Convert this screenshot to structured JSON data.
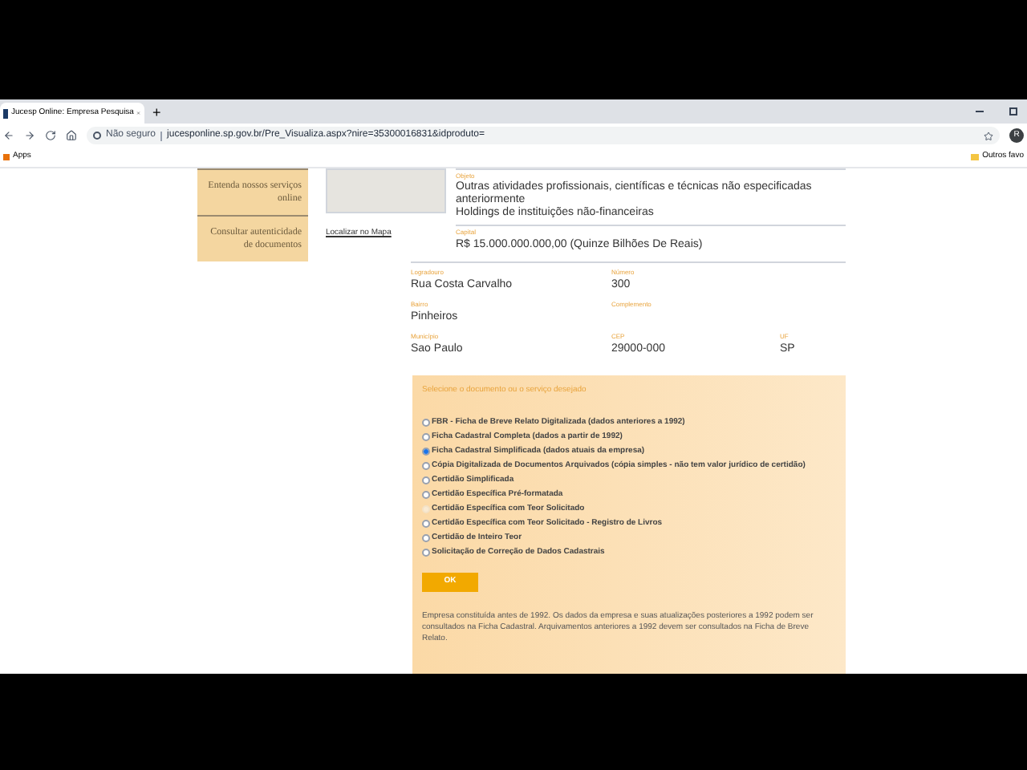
{
  "browser": {
    "tab_title": "Jucesp Online: Empresa Pesquisa",
    "new_tab": "+",
    "security": "Não seguro",
    "url": "jucesponline.sp.gov.br/Pre_Visualiza.aspx?nire=35300016831&idproduto=",
    "avatar": "R",
    "bookmarks": [
      "Apps"
    ],
    "other_bookmarks": "Outros favo"
  },
  "sidebar": {
    "items": [
      "Entenda nossos serviços online",
      "Consultar autenticidade de documentos"
    ]
  },
  "map": {
    "link": "Localizar no Mapa"
  },
  "objeto": {
    "label": "Objeto",
    "lines": [
      "Outras atividades profissionais, científicas e técnicas não especificadas anteriormente",
      "Holdings de instituições não-financeiras"
    ]
  },
  "capital": {
    "label": "Capital",
    "value": "R$ 15.000.000.000,00 (Quinze Bilhões De Reais)"
  },
  "address": [
    [
      {
        "label": "Logradouro",
        "value": "Rua Costa Carvalho"
      },
      {
        "label": "Número",
        "value": "300"
      }
    ],
    [
      {
        "label": "Bairro",
        "value": "Pinheiros"
      },
      {
        "label": "Complemento"
      }
    ],
    [
      {
        "label": "Município",
        "value": "Sao Paulo"
      },
      {
        "label": "CEP",
        "value": "29000-000"
      },
      {
        "label": "UF",
        "value": "SP"
      }
    ]
  ],
  "form": {
    "title": "Selecione o documento ou o serviço desejado",
    "options": [
      {
        "label": "FBR - Ficha de Breve Relato Digitalizada (dados anteriores a 1992)",
        "selected": false,
        "disabled": false
      },
      {
        "label": "Ficha Cadastral Completa (dados a partir de 1992)",
        "selected": false,
        "disabled": false
      },
      {
        "label": "Ficha Cadastral Simplificada (dados atuais da empresa)",
        "selected": true,
        "disabled": false
      },
      {
        "label": "Cópia Digitalizada de Documentos Arquivados (cópia simples - não tem valor jurídico de certidão)",
        "selected": false,
        "disabled": false
      },
      {
        "label": "Certidão Simplificada",
        "selected": false,
        "disabled": false
      },
      {
        "label": "Certidão Específica Pré-formatada",
        "selected": false,
        "disabled": false
      },
      {
        "label": "Certidão Específica com Teor Solicitado",
        "selected": false,
        "disabled": true
      },
      {
        "label": "Certidão Específica com Teor Solicitado - Registro de Livros",
        "selected": false,
        "disabled": false
      },
      {
        "label": "Certidão de Inteiro Teor",
        "selected": false,
        "disabled": false
      },
      {
        "label": "Solicitação de Correção de Dados Cadastrais",
        "selected": false,
        "disabled": false
      }
    ],
    "button": "OK",
    "note": "Empresa constituída antes de 1992. Os dados da empresa e suas atualizações posteriores a 1992 podem ser consultados na Ficha Cadastral. Arquivamentos anteriores a 1992 devem ser consultados na Ficha de Breve Relato."
  }
}
